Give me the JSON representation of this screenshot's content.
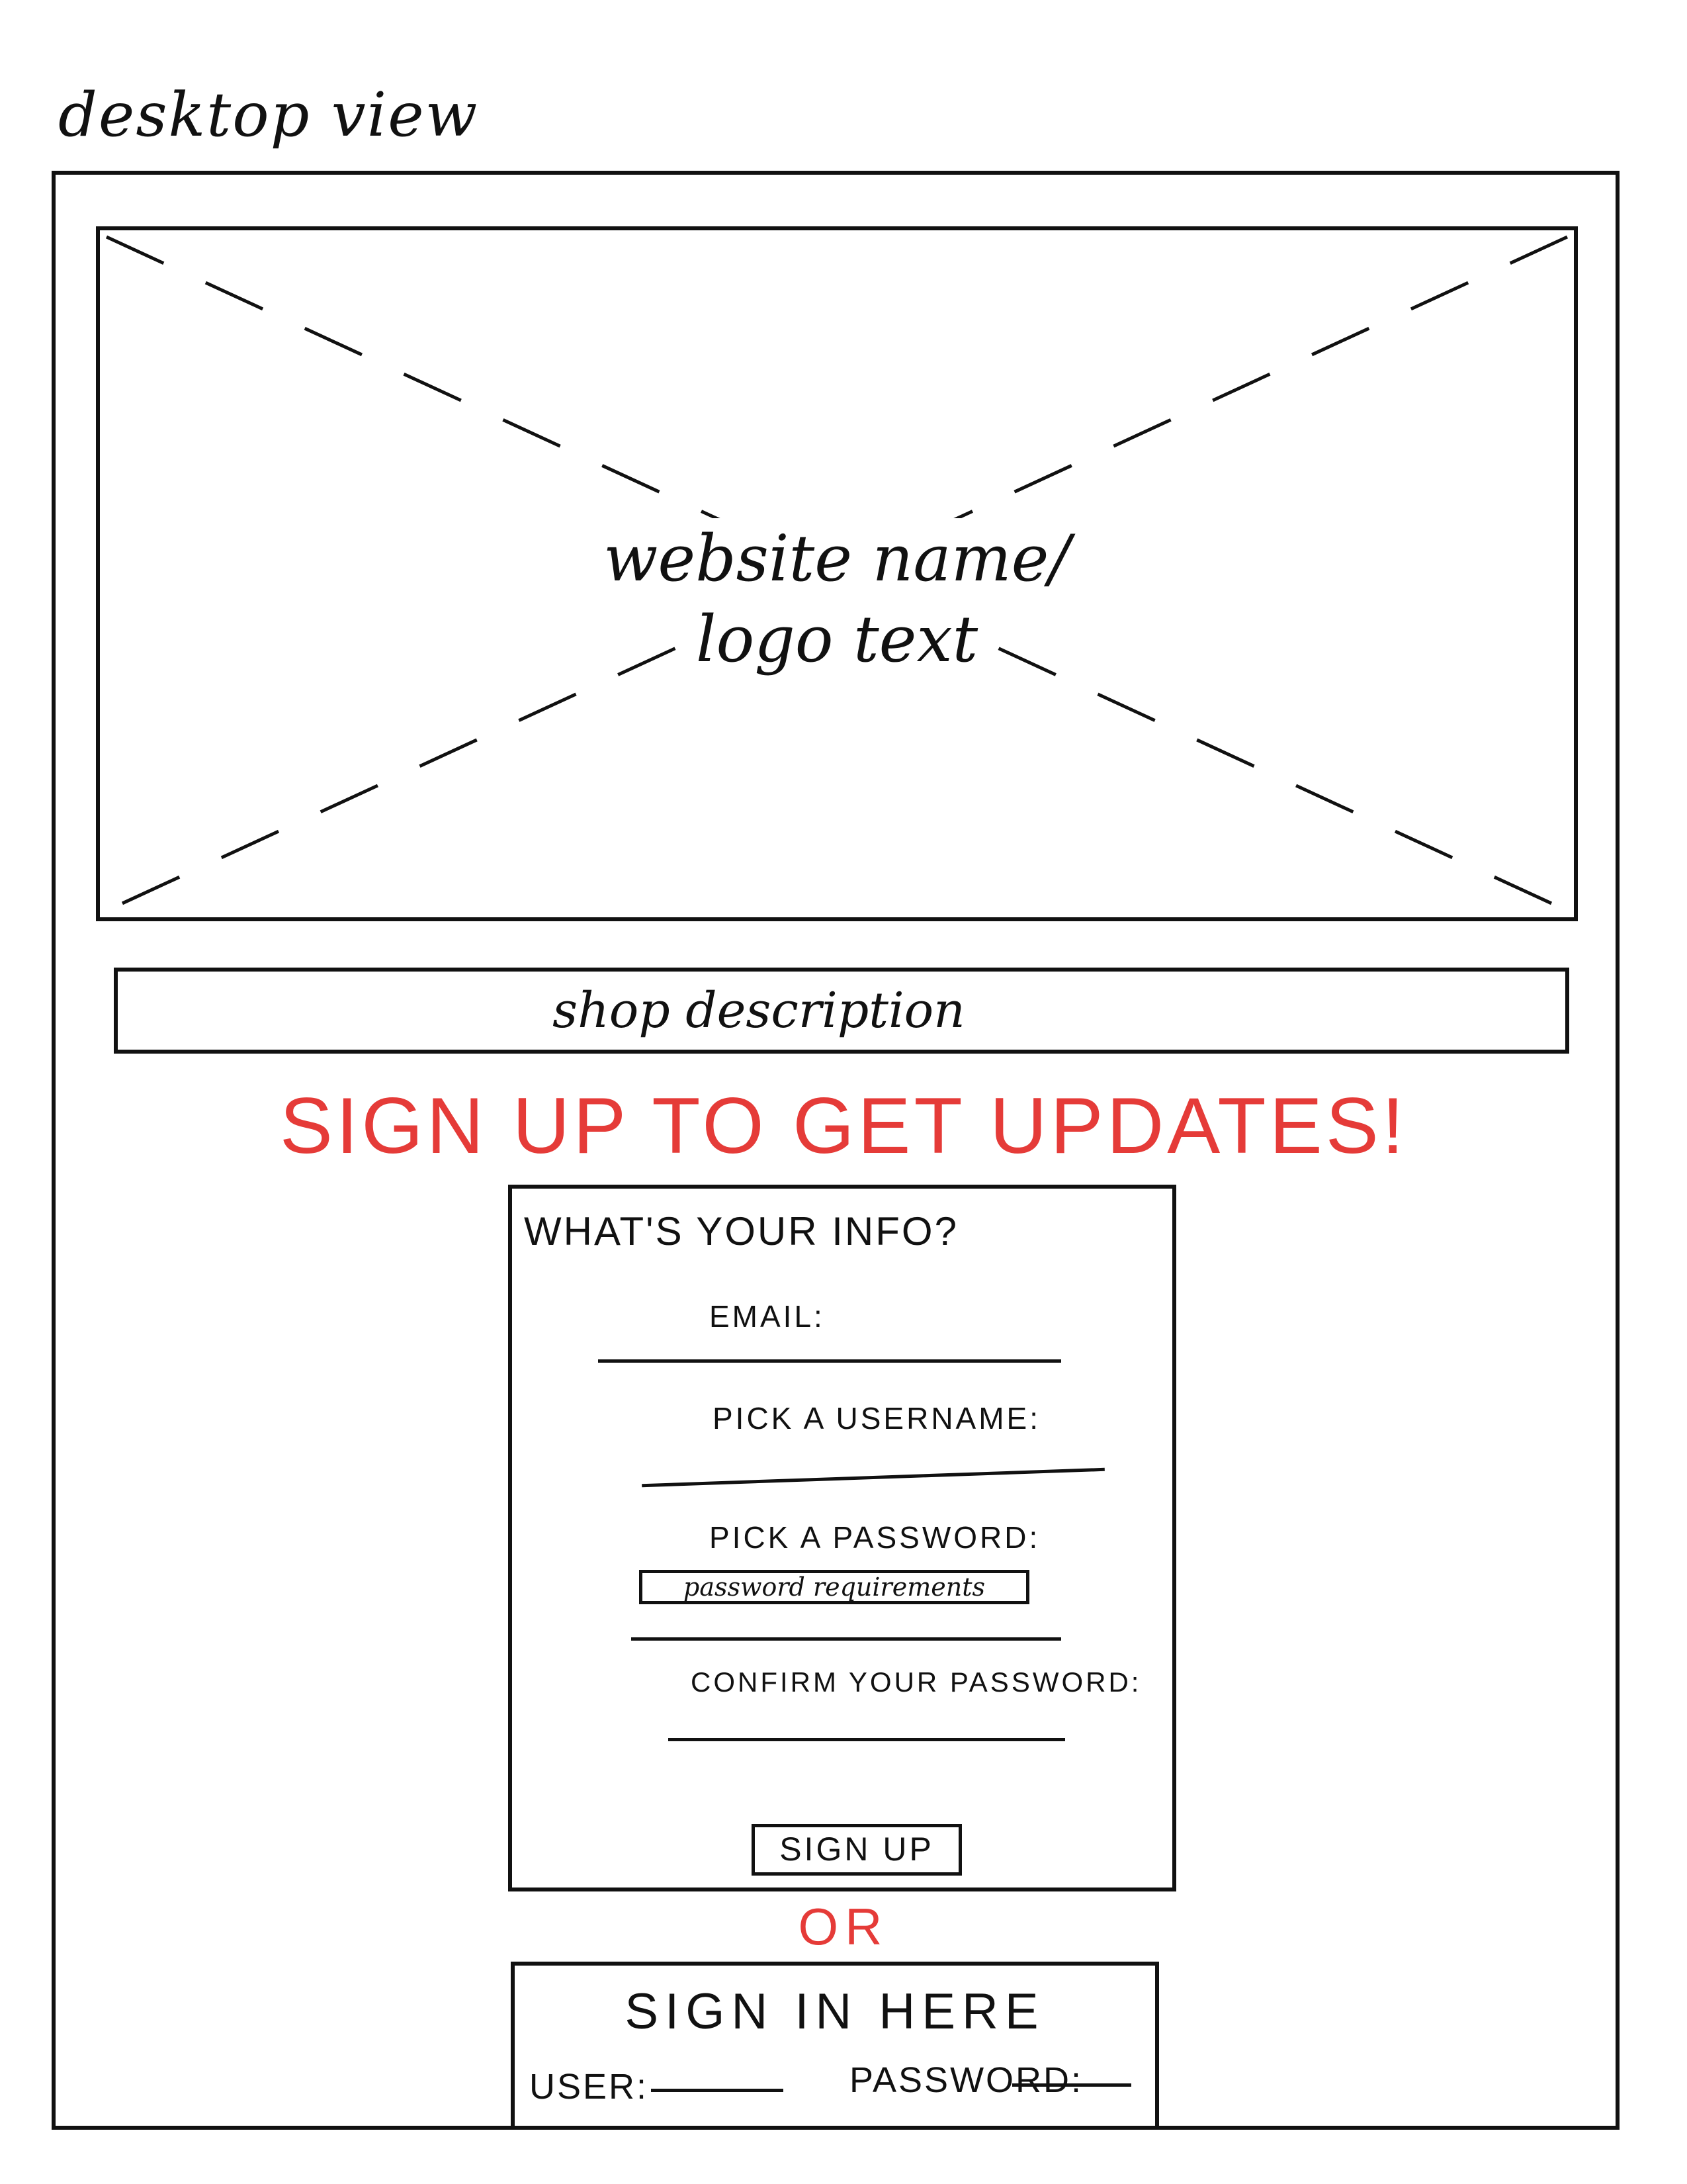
{
  "page": {
    "title": "desktop view"
  },
  "hero": {
    "line1": "website name/",
    "line2": "logo text"
  },
  "shop": {
    "description": "shop description"
  },
  "signup": {
    "headline": "SIGN UP TO GET UPDATES!",
    "form_heading": "WHAT'S YOUR INFO?",
    "email_label": "EMAIL:",
    "username_label": "PICK A USERNAME:",
    "password_label": "PICK A PASSWORD:",
    "password_requirements": "password requirements",
    "confirm_label": "CONFIRM YOUR PASSWORD:",
    "button_label": "SIGN UP"
  },
  "divider": {
    "or_label": "OR"
  },
  "signin": {
    "title": "SIGN IN HERE",
    "user_label": "USER:",
    "password_label": "PASSWORD:"
  },
  "colors": {
    "accent": "#e53b38",
    "ink": "#111111"
  }
}
